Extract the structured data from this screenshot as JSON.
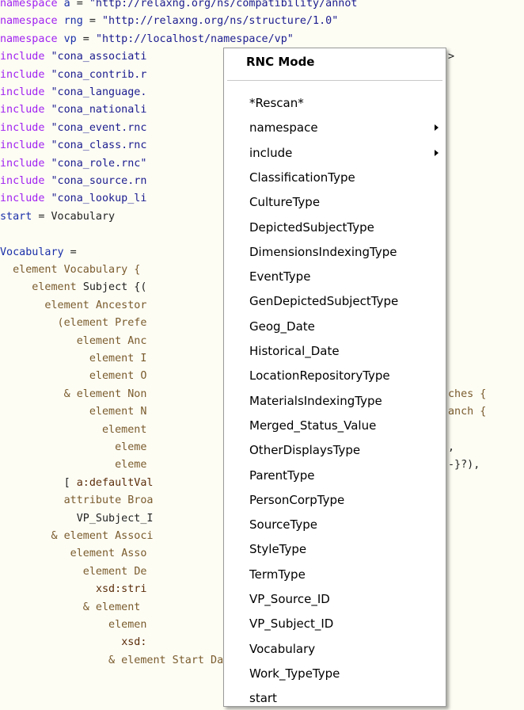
{
  "editor": {
    "lines": [
      [
        [
          "namespace ",
          "kw"
        ],
        [
          "a",
          "id"
        ],
        [
          " = ",
          "plain"
        ],
        [
          "\"http://relaxng.org/ns/compatibility/annot",
          "str"
        ]
      ],
      [
        [
          "namespace ",
          "kw"
        ],
        [
          "rng",
          "id"
        ],
        [
          " = ",
          "plain"
        ],
        [
          "\"http://relaxng.org/ns/structure/1.0\"",
          "str"
        ]
      ],
      [
        [
          "namespace ",
          "kw"
        ],
        [
          "vp",
          "id"
        ],
        [
          " = ",
          "plain"
        ],
        [
          "\"http://localhost/namespace/vp\"",
          "str"
        ]
      ],
      [
        [
          "include ",
          "kw"
        ],
        [
          "\"cona_associati",
          "str"
        ],
        [
          "",
          "plain"
        ]
      ],
      [
        [
          "include ",
          "kw"
        ],
        [
          "\"cona_contrib.r",
          "str"
        ]
      ],
      [
        [
          "include ",
          "kw"
        ],
        [
          "\"cona_language.",
          "str"
        ]
      ],
      [
        [
          "include ",
          "kw"
        ],
        [
          "\"cona_nationali",
          "str"
        ]
      ],
      [
        [
          "include ",
          "kw"
        ],
        [
          "\"cona_event.rnc",
          "str"
        ]
      ],
      [
        [
          "include ",
          "kw"
        ],
        [
          "\"cona_class.rnc",
          "str"
        ]
      ],
      [
        [
          "include ",
          "kw"
        ],
        [
          "\"cona_role.rnc\"",
          "str"
        ]
      ],
      [
        [
          "include ",
          "kw"
        ],
        [
          "\"cona_source.rn",
          "str"
        ]
      ],
      [
        [
          "include ",
          "kw"
        ],
        [
          "\"cona_lookup_li",
          "str"
        ]
      ],
      [
        [
          "start",
          "id"
        ],
        [
          " = Vocabulary",
          "plain"
        ]
      ],
      [
        [
          "",
          "plain"
        ]
      ],
      [
        [
          "Vocabulary",
          "id"
        ],
        [
          " =",
          "plain"
        ]
      ],
      [
        [
          "  element ",
          "el"
        ],
        [
          "Vocabulary {",
          "el"
        ]
      ],
      [
        [
          "     element ",
          "el"
        ],
        [
          "Subject {(",
          "plain"
        ]
      ],
      [
        [
          "       element ",
          "el"
        ],
        [
          "Ancestor",
          "el"
        ]
      ],
      [
        [
          "         (element ",
          "el"
        ],
        [
          "Prefe",
          "el"
        ]
      ],
      [
        [
          "            element ",
          "el"
        ],
        [
          "Anc",
          "el"
        ]
      ],
      [
        [
          "              element ",
          "el"
        ],
        [
          "I",
          "el"
        ]
      ],
      [
        [
          "              element ",
          "el"
        ],
        [
          "O",
          "el"
        ]
      ],
      [
        [
          "          & element ",
          "el"
        ],
        [
          "Non",
          "el"
        ]
      ],
      [
        [
          "              element ",
          "el"
        ],
        [
          "N",
          "el"
        ]
      ],
      [
        [
          "                element",
          "el"
        ]
      ],
      [
        [
          "                  eleme",
          "el"
        ]
      ],
      [
        [
          "                  eleme",
          "el"
        ]
      ],
      [
        [
          "          [ ",
          "plain"
        ],
        [
          "a:defaultVal",
          "at"
        ]
      ],
      [
        [
          "          attribute ",
          "el"
        ],
        [
          "Broa",
          "el"
        ]
      ],
      [
        [
          "            VP_Subject_I",
          "plain"
        ]
      ],
      [
        [
          "        & element ",
          "el"
        ],
        [
          "Associ",
          "el"
        ]
      ],
      [
        [
          "           element ",
          "el"
        ],
        [
          "Asso",
          "el"
        ]
      ],
      [
        [
          "             element ",
          "el"
        ],
        [
          "De",
          "el"
        ]
      ],
      [
        [
          "               ",
          "plain"
        ],
        [
          "xsd:stri",
          "at"
        ]
      ],
      [
        [
          "             & element ",
          "el"
        ]
      ],
      [
        [
          "                 elemen",
          "el"
        ]
      ],
      [
        [
          "                   ",
          "plain"
        ],
        [
          "xsd:",
          "at"
        ]
      ],
      [
        [
          "                 & element ",
          "el"
        ],
        [
          "Start Date {",
          "el"
        ]
      ]
    ],
    "right_fragments": [
      {
        "text": ">",
        "line": 3
      },
      {
        "text": "ches {",
        "line": 22
      },
      {
        "text": "anch {",
        "line": 23
      },
      {
        "text": ",",
        "line": 25
      },
      {
        "text": "-}?),",
        "line": 26
      }
    ]
  },
  "context_menu": {
    "title": "RNC Mode",
    "items": [
      {
        "label": "*Rescan*",
        "submenu": false
      },
      {
        "label": "namespace",
        "submenu": true
      },
      {
        "label": "include",
        "submenu": true
      },
      {
        "label": "ClassificationType",
        "submenu": false
      },
      {
        "label": "CultureType",
        "submenu": false
      },
      {
        "label": "DepictedSubjectType",
        "submenu": false
      },
      {
        "label": "DimensionsIndexingType",
        "submenu": false
      },
      {
        "label": "EventType",
        "submenu": false
      },
      {
        "label": "GenDepictedSubjectType",
        "submenu": false
      },
      {
        "label": "Geog_Date",
        "submenu": false
      },
      {
        "label": "Historical_Date",
        "submenu": false
      },
      {
        "label": "LocationRepositoryType",
        "submenu": false
      },
      {
        "label": "MaterialsIndexingType",
        "submenu": false
      },
      {
        "label": "Merged_Status_Value",
        "submenu": false
      },
      {
        "label": "OtherDisplaysType",
        "submenu": false
      },
      {
        "label": "ParentType",
        "submenu": false
      },
      {
        "label": "PersonCorpType",
        "submenu": false
      },
      {
        "label": "SourceType",
        "submenu": false
      },
      {
        "label": "StyleType",
        "submenu": false
      },
      {
        "label": "TermType",
        "submenu": false
      },
      {
        "label": "VP_Source_ID",
        "submenu": false
      },
      {
        "label": "VP_Subject_ID",
        "submenu": false
      },
      {
        "label": "Vocabulary",
        "submenu": false
      },
      {
        "label": "Work_TypeType",
        "submenu": false
      },
      {
        "label": "start",
        "submenu": false
      }
    ]
  }
}
